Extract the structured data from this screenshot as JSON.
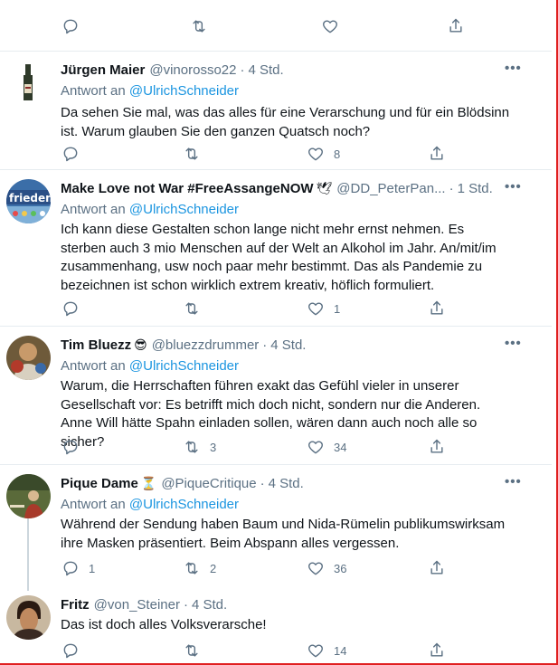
{
  "top_actions": {
    "reply_count": "",
    "retweet_count": "",
    "like_count": ""
  },
  "tweets": [
    {
      "name": "Jürgen Maier",
      "handle": "@vinorosso22",
      "time": "4 Std.",
      "reply_prefix": "Antwort an",
      "reply_to": "@UlrichSchneider",
      "text": "Da sehen Sie mal, was das alles für eine Verarschung und für ein Blödsinn ist. Warum glauben Sie den ganzen Quatsch noch?",
      "reply_count": "",
      "retweet_count": "",
      "like_count": "8",
      "avatar": "wine-bottle"
    },
    {
      "name": "Make Love not War #FreeAssangeNOW",
      "badge": "🕊",
      "handle": "@DD_PeterPan...",
      "time": "1 Std.",
      "reply_prefix": "Antwort an",
      "reply_to": "@UlrichSchneider",
      "text": "Ich kann diese Gestalten schon lange nicht mehr ernst nehmen. Es sterben auch 3 mio Menschen auf der Welt an Alkohol im Jahr. An/mit/im zusammenhang, usw noch paar mehr bestimmt. Das als Pandemie zu bezeichnen ist schon wirklich extrem kreativ, höflich formuliert.",
      "reply_count": "",
      "retweet_count": "",
      "like_count": "1",
      "avatar": "frieden-sign"
    },
    {
      "name": "Tim Bluezz",
      "badge": "😎",
      "handle": "@bluezzdrummer",
      "time": "4 Std.",
      "reply_prefix": "Antwort an",
      "reply_to": "@UlrichSchneider",
      "text": "Warum, die Herrschaften führen exakt das Gefühl vieler in unserer Gesellschaft vor: Es betrifft mich doch nicht, sondern nur die Anderen. Anne Will hätte Spahn einladen sollen, wären dann auch noch alle so sicher?",
      "reply_count": "",
      "retweet_count": "3",
      "like_count": "34",
      "avatar": "drummer"
    },
    {
      "name": "Pique Dame",
      "badge": "⏳",
      "handle": "@PiqueCritique",
      "time": "4 Std.",
      "reply_prefix": "Antwort an",
      "reply_to": "@UlrichSchneider",
      "text": "Während der Sendung haben Baum und Nida-Rümelin publikumswirksam ihre Masken präsentiert. Beim Abspann alles vergessen.",
      "reply_count": "1",
      "retweet_count": "2",
      "like_count": "36",
      "avatar": "cafe-scene"
    },
    {
      "name": "Fritz",
      "handle": "@von_Steiner",
      "time": "4 Std.",
      "text": "Das ist doch alles Volksverarsche!",
      "reply_count": "",
      "retweet_count": "",
      "like_count": "14",
      "avatar": "portrait"
    }
  ],
  "colors": {
    "text": "#0f1419",
    "muted": "#5b7083",
    "link": "#1b95e0",
    "border": "#e6ecf0"
  }
}
